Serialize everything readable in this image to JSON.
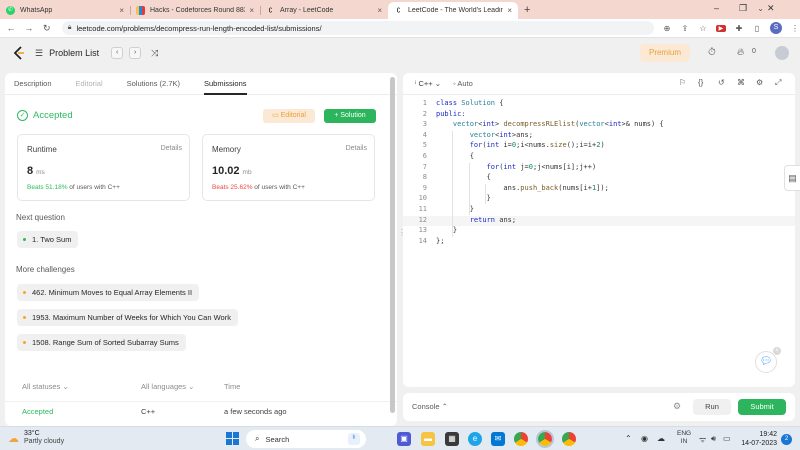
{
  "browser": {
    "tabs": [
      {
        "title": "WhatsApp",
        "icon": "whatsapp-icon"
      },
      {
        "title": "Hacks - Codeforces Round 883 (",
        "icon": "codeforces-icon"
      },
      {
        "title": "Array - LeetCode",
        "icon": "leetcode-icon"
      },
      {
        "title": "LeetCode - The World's Leading",
        "icon": "leetcode-icon",
        "active": true
      }
    ],
    "new_tab": "+",
    "url": "leetcode.com/problems/decompress-run-length-encoded-list/submissions/",
    "profile_initial": "S"
  },
  "nav": {
    "problem_list": "Problem List",
    "premium": "Premium",
    "fire_count": "0"
  },
  "left": {
    "tabs": [
      "Description",
      "Editorial",
      "Solutions (2.7K)",
      "Submissions"
    ],
    "status": "Accepted",
    "editorial_btn": "Editorial",
    "solution_btn": "Solution",
    "runtime": {
      "label": "Runtime",
      "details": "Details",
      "value": "8",
      "unit": "ms",
      "beats": "Beats 51.18%",
      "suffix": "of users with C++"
    },
    "memory": {
      "label": "Memory",
      "details": "Details",
      "value": "10.02",
      "unit": "mb",
      "beats": "Beats 25.62%",
      "suffix": "of users with C++"
    },
    "next_question_label": "Next question",
    "next_question": "1. Two Sum",
    "more_challenges_label": "More challenges",
    "challenges": [
      "462. Minimum Moves to Equal Array Elements II",
      "1953. Maximum Number of Weeks for Which You Can Work",
      "1508. Range Sum of Sorted Subarray Sums"
    ],
    "filter": {
      "statuses": "All statuses",
      "languages": "All languages",
      "time": "Time"
    },
    "row": {
      "status": "Accepted",
      "language": "C++",
      "time": "a few seconds ago"
    }
  },
  "editor": {
    "language": "C++",
    "mode": "Auto",
    "current_line": 12,
    "lines": [
      "class Solution {",
      "public:",
      "    vector<int> decompressRLElist(vector<int>& nums) {",
      "        vector<int>ans;",
      "        for(int i=0;i<nums.size();i=i+2)",
      "        {",
      "            for(int j=0;j<nums[i];j++)",
      "            {",
      "                ans.push_back(nums[i+1]);",
      "            }",
      "        }",
      "        return ans;",
      "    }",
      "};"
    ]
  },
  "console": {
    "label": "Console",
    "run": "Run",
    "submit": "Submit"
  },
  "taskbar": {
    "temp": "33°C",
    "weather": "Partly cloudy",
    "search": "Search",
    "lang1": "ENG",
    "lang2": "IN",
    "time": "19:42",
    "date": "14-07-2023",
    "notifications": "2"
  },
  "colors": {
    "accepted": "#2cbb5d",
    "premium": "#e7a13b",
    "beats_low": "#ef4743"
  }
}
